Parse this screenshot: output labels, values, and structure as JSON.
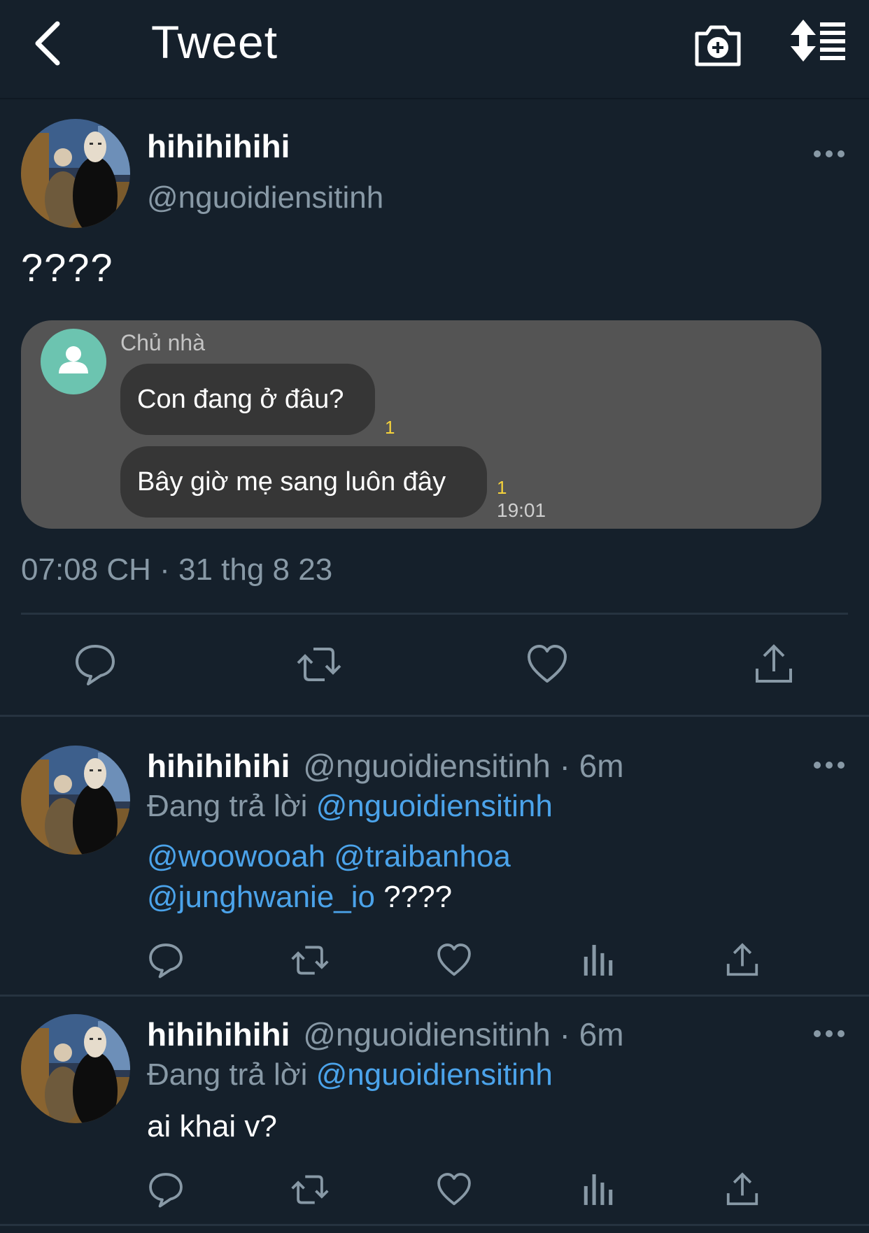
{
  "header": {
    "title": "Tweet"
  },
  "main_tweet": {
    "display_name": "hihihihihi",
    "handle": "@nguoidiensitinh",
    "text": "????",
    "timestamp": "07:08 CH · 31 thg 8 23",
    "attachment": {
      "sender_name": "Chủ nhà",
      "messages": [
        {
          "text": "Con đang ở đâu?",
          "read_count": "1"
        },
        {
          "text": "Bây giờ mẹ sang luôn đây",
          "read_count": "1",
          "time": "19:01"
        }
      ]
    }
  },
  "replies": [
    {
      "display_name": "hihihihihi",
      "handle_time": "@nguoidiensitinh · 6m",
      "replying_prefix": "Đang trả lời",
      "replying_to": "@nguoidiensitinh",
      "mention_1": "@woowooah",
      "mention_2": "@traibanhoa",
      "mention_3": "@junghwanie_io",
      "text_tail": "????"
    },
    {
      "display_name": "hihihihihi",
      "handle_time": "@nguoidiensitinh · 6m",
      "replying_prefix": "Đang trả lời",
      "replying_to": "@nguoidiensitinh",
      "text": "ai khai v?"
    }
  ],
  "colors": {
    "background": "#15202b",
    "link": "#4ba3ea",
    "secondary_text": "#8899a6",
    "attachment_bg": "#545454",
    "bubble_bg": "#363636",
    "read_indicator": "#f5d23b",
    "contact_avatar": "#6cc4b0"
  },
  "icons": [
    "back-arrow-icon",
    "camera-plus-icon",
    "sort-icon",
    "more-icon",
    "reply-icon",
    "retweet-icon",
    "like-icon",
    "share-icon",
    "analytics-icon",
    "contact-avatar-icon"
  ]
}
